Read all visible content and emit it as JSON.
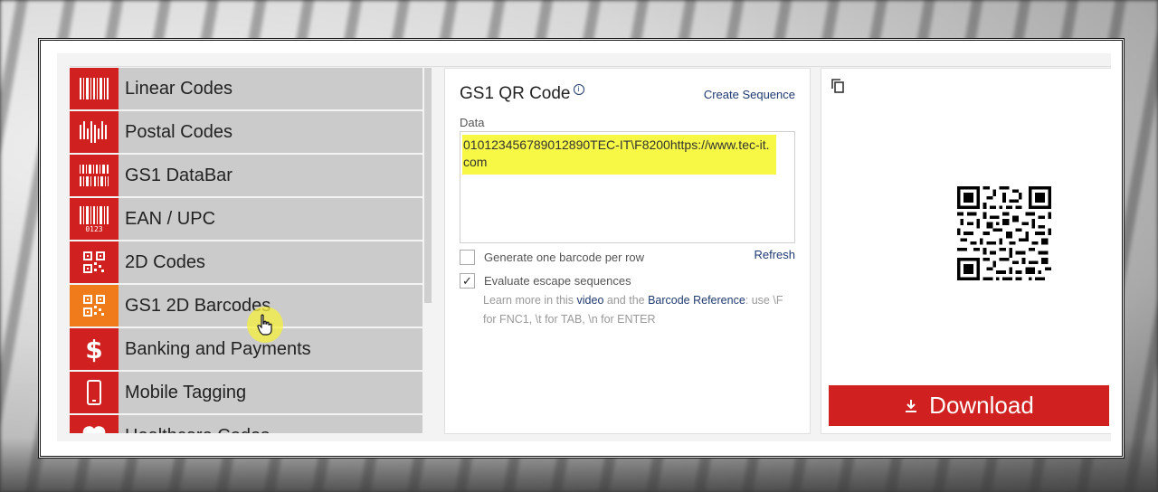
{
  "categories": [
    {
      "label": "Linear Codes",
      "icon": "linear-barcode-icon",
      "active": false
    },
    {
      "label": "Postal Codes",
      "icon": "postal-barcode-icon",
      "active": false
    },
    {
      "label": "GS1 DataBar",
      "icon": "databar-icon",
      "active": false
    },
    {
      "label": "EAN / UPC",
      "icon": "ean-upc-icon",
      "active": false
    },
    {
      "label": "2D Codes",
      "icon": "qr-code-icon",
      "active": false
    },
    {
      "label": "GS1 2D Barcodes",
      "icon": "qr-code-icon",
      "active": true
    },
    {
      "label": "Banking and Payments",
      "icon": "dollar-icon",
      "active": false
    },
    {
      "label": "Mobile Tagging",
      "icon": "mobile-phone-icon",
      "active": false
    },
    {
      "label": "Healthcare Codes",
      "icon": "heart-icon",
      "active": false
    }
  ],
  "editor": {
    "title": "GS1 QR Code",
    "create_sequence": "Create Sequence",
    "data_label": "Data",
    "data_value": "010123456789012890TEC-IT\\F8200https://www.tec-it.com",
    "option_one_per_row": "Generate one barcode per row",
    "option_escape": "Evaluate escape sequences",
    "option_one_per_row_checked": false,
    "option_escape_checked": true,
    "refresh": "Refresh",
    "help_prefix": "Learn more in this ",
    "help_video": "video",
    "help_middle": " and the ",
    "help_reference": "Barcode Reference",
    "help_suffix": ": use \\F for FNC1, \\t for TAB, \\n for ENTER"
  },
  "preview": {
    "download_label": "Download"
  },
  "colors": {
    "brand_red": "#d0201f",
    "active_orange": "#f07b1a",
    "highlight_yellow": "#f7f746",
    "link_blue": "#1f3a70"
  }
}
